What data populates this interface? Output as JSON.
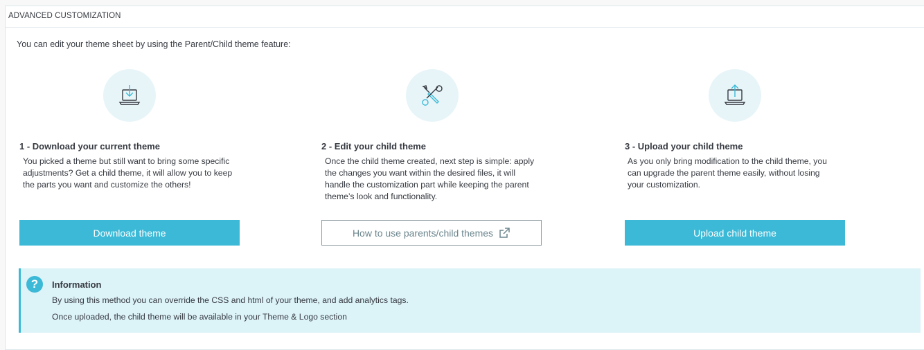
{
  "panel": {
    "title": "ADVANCED CUSTOMIZATION",
    "intro": "You can edit your theme sheet by using the Parent/Child theme feature:"
  },
  "steps": [
    {
      "icon": "download-laptop-icon",
      "title": "1 - Download your current theme",
      "desc_lines": [
        "You picked a theme but still want to bring some specific",
        "adjustments? Get a child theme, it will allow you to keep",
        "the parts you want and customize the others!"
      ],
      "button": "Download theme"
    },
    {
      "icon": "tools-icon",
      "title": "2 - Edit your child theme",
      "desc_lines": [
        "Once the child theme created, next step is simple: apply",
        "the changes you want within the desired files, it will",
        "handle the customization part while keeping the parent",
        "theme’s look and functionality."
      ],
      "button": "How to use parents/child themes"
    },
    {
      "icon": "upload-laptop-icon",
      "title": "3 - Upload your child theme",
      "desc_lines": [
        "As you only bring modification to the child theme, you",
        "can upgrade the parent theme easily, without losing",
        "your customization."
      ],
      "button": "Upload child theme"
    }
  ],
  "info": {
    "icon": "question-circle-icon",
    "title": "Information",
    "lines": [
      "By using this method you can override the CSS and html of your theme, and add analytics tags.",
      "Once uploaded, the child theme will be available in your Theme & Logo section"
    ]
  },
  "colors": {
    "accent": "#3bb9d7",
    "icon_bg": "#e7f5f9",
    "info_bg": "#dcf3f8",
    "text": "#363a41"
  }
}
